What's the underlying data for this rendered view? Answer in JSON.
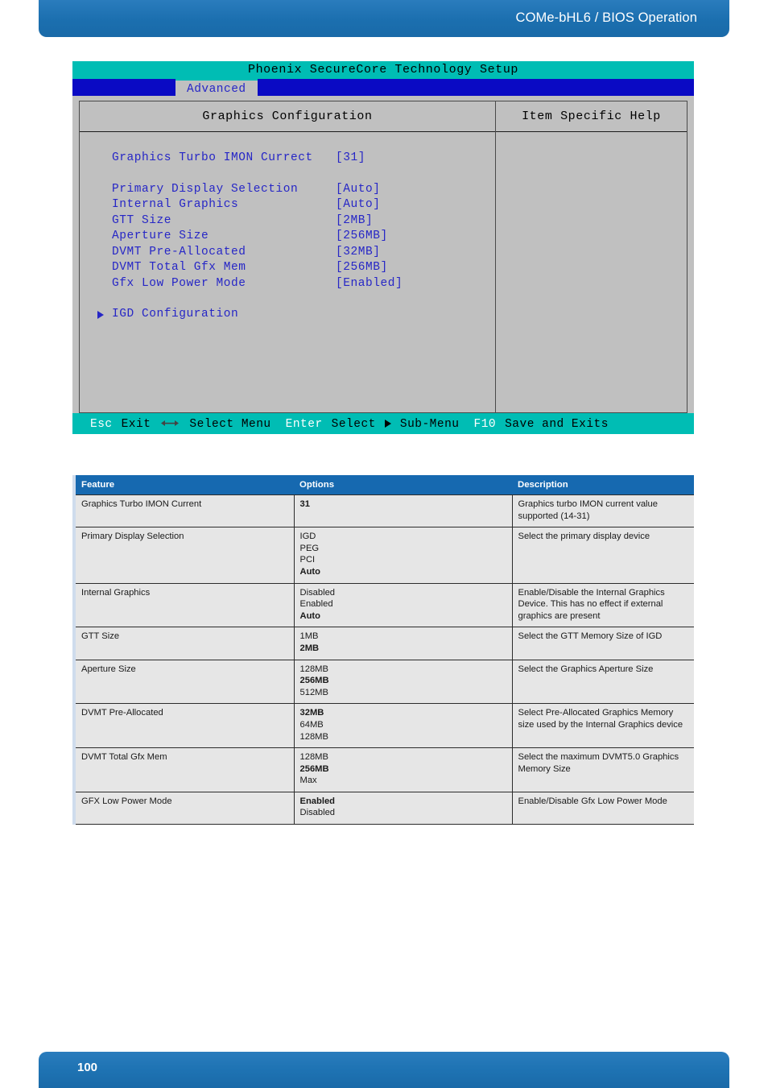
{
  "header": {
    "title": "COMe-bHL6 / BIOS Operation"
  },
  "bios": {
    "title": "Phoenix SecureCore Technology Setup",
    "active_tab": "Advanced",
    "left_panel_heading": "Graphics Configuration",
    "right_panel_heading": "Item Specific Help",
    "settings": [
      {
        "label": "Graphics Turbo IMON Currect",
        "value": "[31]",
        "gap_after": true
      },
      {
        "label": "Primary Display Selection",
        "value": "[Auto]",
        "gap_after": false
      },
      {
        "label": "Internal Graphics",
        "value": "[Auto]",
        "gap_after": false
      },
      {
        "label": "GTT Size",
        "value": "[2MB]",
        "gap_after": false
      },
      {
        "label": "Aperture Size",
        "value": "[256MB]",
        "gap_after": false
      },
      {
        "label": "DVMT Pre-Allocated",
        "value": "[32MB]",
        "gap_after": false
      },
      {
        "label": "DVMT Total Gfx Mem",
        "value": "[256MB]",
        "gap_after": false
      },
      {
        "label": "Gfx Low Power Mode",
        "value": "[Enabled]",
        "gap_after": false
      }
    ],
    "submenu": {
      "label": "IGD Configuration",
      "icon": "triangle-right-icon"
    },
    "footer_keys": {
      "esc": "Esc",
      "esc_action": "Exit",
      "arrows_action": "Select Menu",
      "enter": "Enter",
      "enter_action": "Select",
      "submenu_action": "Sub-Menu",
      "f10": "F10",
      "f10_action": "Save and Exits"
    }
  },
  "spec_table": {
    "columns": [
      "Feature",
      "Options",
      "Description"
    ],
    "rows": [
      {
        "feature": "Graphics Turbo IMON Current",
        "options": [
          {
            "text": "31",
            "default": true
          }
        ],
        "description": "Graphics turbo IMON current value supported (14-31)"
      },
      {
        "feature": "Primary Display Selection",
        "options": [
          {
            "text": "IGD",
            "default": false
          },
          {
            "text": "PEG",
            "default": false
          },
          {
            "text": "PCI",
            "default": false
          },
          {
            "text": "Auto",
            "default": true
          }
        ],
        "description": "Select the primary display device"
      },
      {
        "feature": "Internal Graphics",
        "options": [
          {
            "text": "Disabled",
            "default": false
          },
          {
            "text": "Enabled",
            "default": false
          },
          {
            "text": "Auto",
            "default": true
          }
        ],
        "description": "Enable/Disable the Internal Graphics Device. This has no effect if external graphics are present"
      },
      {
        "feature": "GTT Size",
        "options": [
          {
            "text": "1MB",
            "default": false
          },
          {
            "text": "2MB",
            "default": true
          }
        ],
        "description": "Select the GTT Memory Size of IGD"
      },
      {
        "feature": "Aperture Size",
        "options": [
          {
            "text": "128MB",
            "default": false
          },
          {
            "text": "256MB",
            "default": true
          },
          {
            "text": "512MB",
            "default": false
          }
        ],
        "description": "Select the Graphics Aperture Size"
      },
      {
        "feature": "DVMT Pre-Allocated",
        "options": [
          {
            "text": "32MB",
            "default": true
          },
          {
            "text": "64MB",
            "default": false
          },
          {
            "text": "128MB",
            "default": false
          }
        ],
        "description": "Select Pre-Allocated Graphics Memory size used by the Internal Graphics device"
      },
      {
        "feature": "DVMT Total Gfx Mem",
        "options": [
          {
            "text": "128MB",
            "default": false
          },
          {
            "text": "256MB",
            "default": true
          },
          {
            "text": "Max",
            "default": false
          }
        ],
        "description": "Select the maximum DVMT5.0 Graphics Memory Size"
      },
      {
        "feature": "GFX Low Power Mode",
        "options": [
          {
            "text": "Enabled",
            "default": true
          },
          {
            "text": "Disabled",
            "default": false
          }
        ],
        "description": "Enable/Disable Gfx Low Power Mode"
      }
    ]
  },
  "footer": {
    "page_number": "100"
  }
}
